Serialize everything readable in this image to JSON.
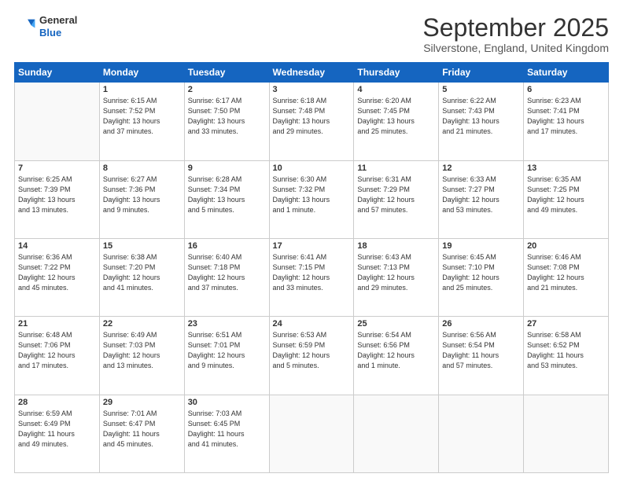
{
  "header": {
    "logo_line1": "General",
    "logo_line2": "Blue",
    "month": "September 2025",
    "location": "Silverstone, England, United Kingdom"
  },
  "days_of_week": [
    "Sunday",
    "Monday",
    "Tuesday",
    "Wednesday",
    "Thursday",
    "Friday",
    "Saturday"
  ],
  "weeks": [
    [
      {
        "day": "",
        "info": ""
      },
      {
        "day": "1",
        "info": "Sunrise: 6:15 AM\nSunset: 7:52 PM\nDaylight: 13 hours\nand 37 minutes."
      },
      {
        "day": "2",
        "info": "Sunrise: 6:17 AM\nSunset: 7:50 PM\nDaylight: 13 hours\nand 33 minutes."
      },
      {
        "day": "3",
        "info": "Sunrise: 6:18 AM\nSunset: 7:48 PM\nDaylight: 13 hours\nand 29 minutes."
      },
      {
        "day": "4",
        "info": "Sunrise: 6:20 AM\nSunset: 7:45 PM\nDaylight: 13 hours\nand 25 minutes."
      },
      {
        "day": "5",
        "info": "Sunrise: 6:22 AM\nSunset: 7:43 PM\nDaylight: 13 hours\nand 21 minutes."
      },
      {
        "day": "6",
        "info": "Sunrise: 6:23 AM\nSunset: 7:41 PM\nDaylight: 13 hours\nand 17 minutes."
      }
    ],
    [
      {
        "day": "7",
        "info": "Sunrise: 6:25 AM\nSunset: 7:39 PM\nDaylight: 13 hours\nand 13 minutes."
      },
      {
        "day": "8",
        "info": "Sunrise: 6:27 AM\nSunset: 7:36 PM\nDaylight: 13 hours\nand 9 minutes."
      },
      {
        "day": "9",
        "info": "Sunrise: 6:28 AM\nSunset: 7:34 PM\nDaylight: 13 hours\nand 5 minutes."
      },
      {
        "day": "10",
        "info": "Sunrise: 6:30 AM\nSunset: 7:32 PM\nDaylight: 13 hours\nand 1 minute."
      },
      {
        "day": "11",
        "info": "Sunrise: 6:31 AM\nSunset: 7:29 PM\nDaylight: 12 hours\nand 57 minutes."
      },
      {
        "day": "12",
        "info": "Sunrise: 6:33 AM\nSunset: 7:27 PM\nDaylight: 12 hours\nand 53 minutes."
      },
      {
        "day": "13",
        "info": "Sunrise: 6:35 AM\nSunset: 7:25 PM\nDaylight: 12 hours\nand 49 minutes."
      }
    ],
    [
      {
        "day": "14",
        "info": "Sunrise: 6:36 AM\nSunset: 7:22 PM\nDaylight: 12 hours\nand 45 minutes."
      },
      {
        "day": "15",
        "info": "Sunrise: 6:38 AM\nSunset: 7:20 PM\nDaylight: 12 hours\nand 41 minutes."
      },
      {
        "day": "16",
        "info": "Sunrise: 6:40 AM\nSunset: 7:18 PM\nDaylight: 12 hours\nand 37 minutes."
      },
      {
        "day": "17",
        "info": "Sunrise: 6:41 AM\nSunset: 7:15 PM\nDaylight: 12 hours\nand 33 minutes."
      },
      {
        "day": "18",
        "info": "Sunrise: 6:43 AM\nSunset: 7:13 PM\nDaylight: 12 hours\nand 29 minutes."
      },
      {
        "day": "19",
        "info": "Sunrise: 6:45 AM\nSunset: 7:10 PM\nDaylight: 12 hours\nand 25 minutes."
      },
      {
        "day": "20",
        "info": "Sunrise: 6:46 AM\nSunset: 7:08 PM\nDaylight: 12 hours\nand 21 minutes."
      }
    ],
    [
      {
        "day": "21",
        "info": "Sunrise: 6:48 AM\nSunset: 7:06 PM\nDaylight: 12 hours\nand 17 minutes."
      },
      {
        "day": "22",
        "info": "Sunrise: 6:49 AM\nSunset: 7:03 PM\nDaylight: 12 hours\nand 13 minutes."
      },
      {
        "day": "23",
        "info": "Sunrise: 6:51 AM\nSunset: 7:01 PM\nDaylight: 12 hours\nand 9 minutes."
      },
      {
        "day": "24",
        "info": "Sunrise: 6:53 AM\nSunset: 6:59 PM\nDaylight: 12 hours\nand 5 minutes."
      },
      {
        "day": "25",
        "info": "Sunrise: 6:54 AM\nSunset: 6:56 PM\nDaylight: 12 hours\nand 1 minute."
      },
      {
        "day": "26",
        "info": "Sunrise: 6:56 AM\nSunset: 6:54 PM\nDaylight: 11 hours\nand 57 minutes."
      },
      {
        "day": "27",
        "info": "Sunrise: 6:58 AM\nSunset: 6:52 PM\nDaylight: 11 hours\nand 53 minutes."
      }
    ],
    [
      {
        "day": "28",
        "info": "Sunrise: 6:59 AM\nSunset: 6:49 PM\nDaylight: 11 hours\nand 49 minutes."
      },
      {
        "day": "29",
        "info": "Sunrise: 7:01 AM\nSunset: 6:47 PM\nDaylight: 11 hours\nand 45 minutes."
      },
      {
        "day": "30",
        "info": "Sunrise: 7:03 AM\nSunset: 6:45 PM\nDaylight: 11 hours\nand 41 minutes."
      },
      {
        "day": "",
        "info": ""
      },
      {
        "day": "",
        "info": ""
      },
      {
        "day": "",
        "info": ""
      },
      {
        "day": "",
        "info": ""
      }
    ]
  ]
}
